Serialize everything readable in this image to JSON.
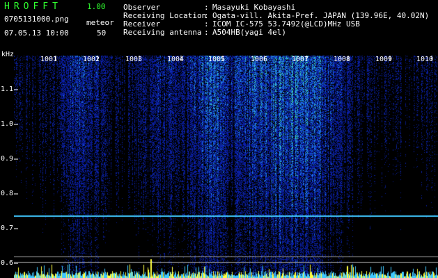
{
  "header": {
    "app_title": "HROFFT",
    "app_version": "1.00",
    "file_name": "0705131000.png",
    "datetime": "07.05.13 10:00",
    "meteor_label": "meteor",
    "meteor_count": "50"
  },
  "info": [
    {
      "label": "Observer",
      "value": "Masayuki Kobayashi"
    },
    {
      "label": "Receiving Location",
      "value": "Ogata-vill. Akita-Pref. JAPAN (139.96E, 40.02N)"
    },
    {
      "label": "Receiver",
      "value": "ICOM IC-575 53.7492(@LCD)MHz USB"
    },
    {
      "label": "Receiving antenna",
      "value": "A504HB(yagi 4el)"
    }
  ],
  "separator": ":",
  "axis": {
    "unit": "kHz",
    "y_ticks": [
      "1.1",
      "1.0",
      "0.9",
      "0.8",
      "0.7",
      "0.6"
    ],
    "x_ticks": [
      "1001",
      "1002",
      "1003",
      "1004",
      "1005",
      "1006",
      "1007",
      "1008",
      "1009",
      "1010"
    ]
  },
  "colors": {
    "background": "#000000",
    "title": "#30ff30",
    "text": "#ffffff",
    "signal_low": "#0a1a7a",
    "signal_mid": "#2a6cff",
    "signal_high": "#40e0c0",
    "meteor_bars": "#ffff40",
    "baseline": "#40c8ff"
  }
}
